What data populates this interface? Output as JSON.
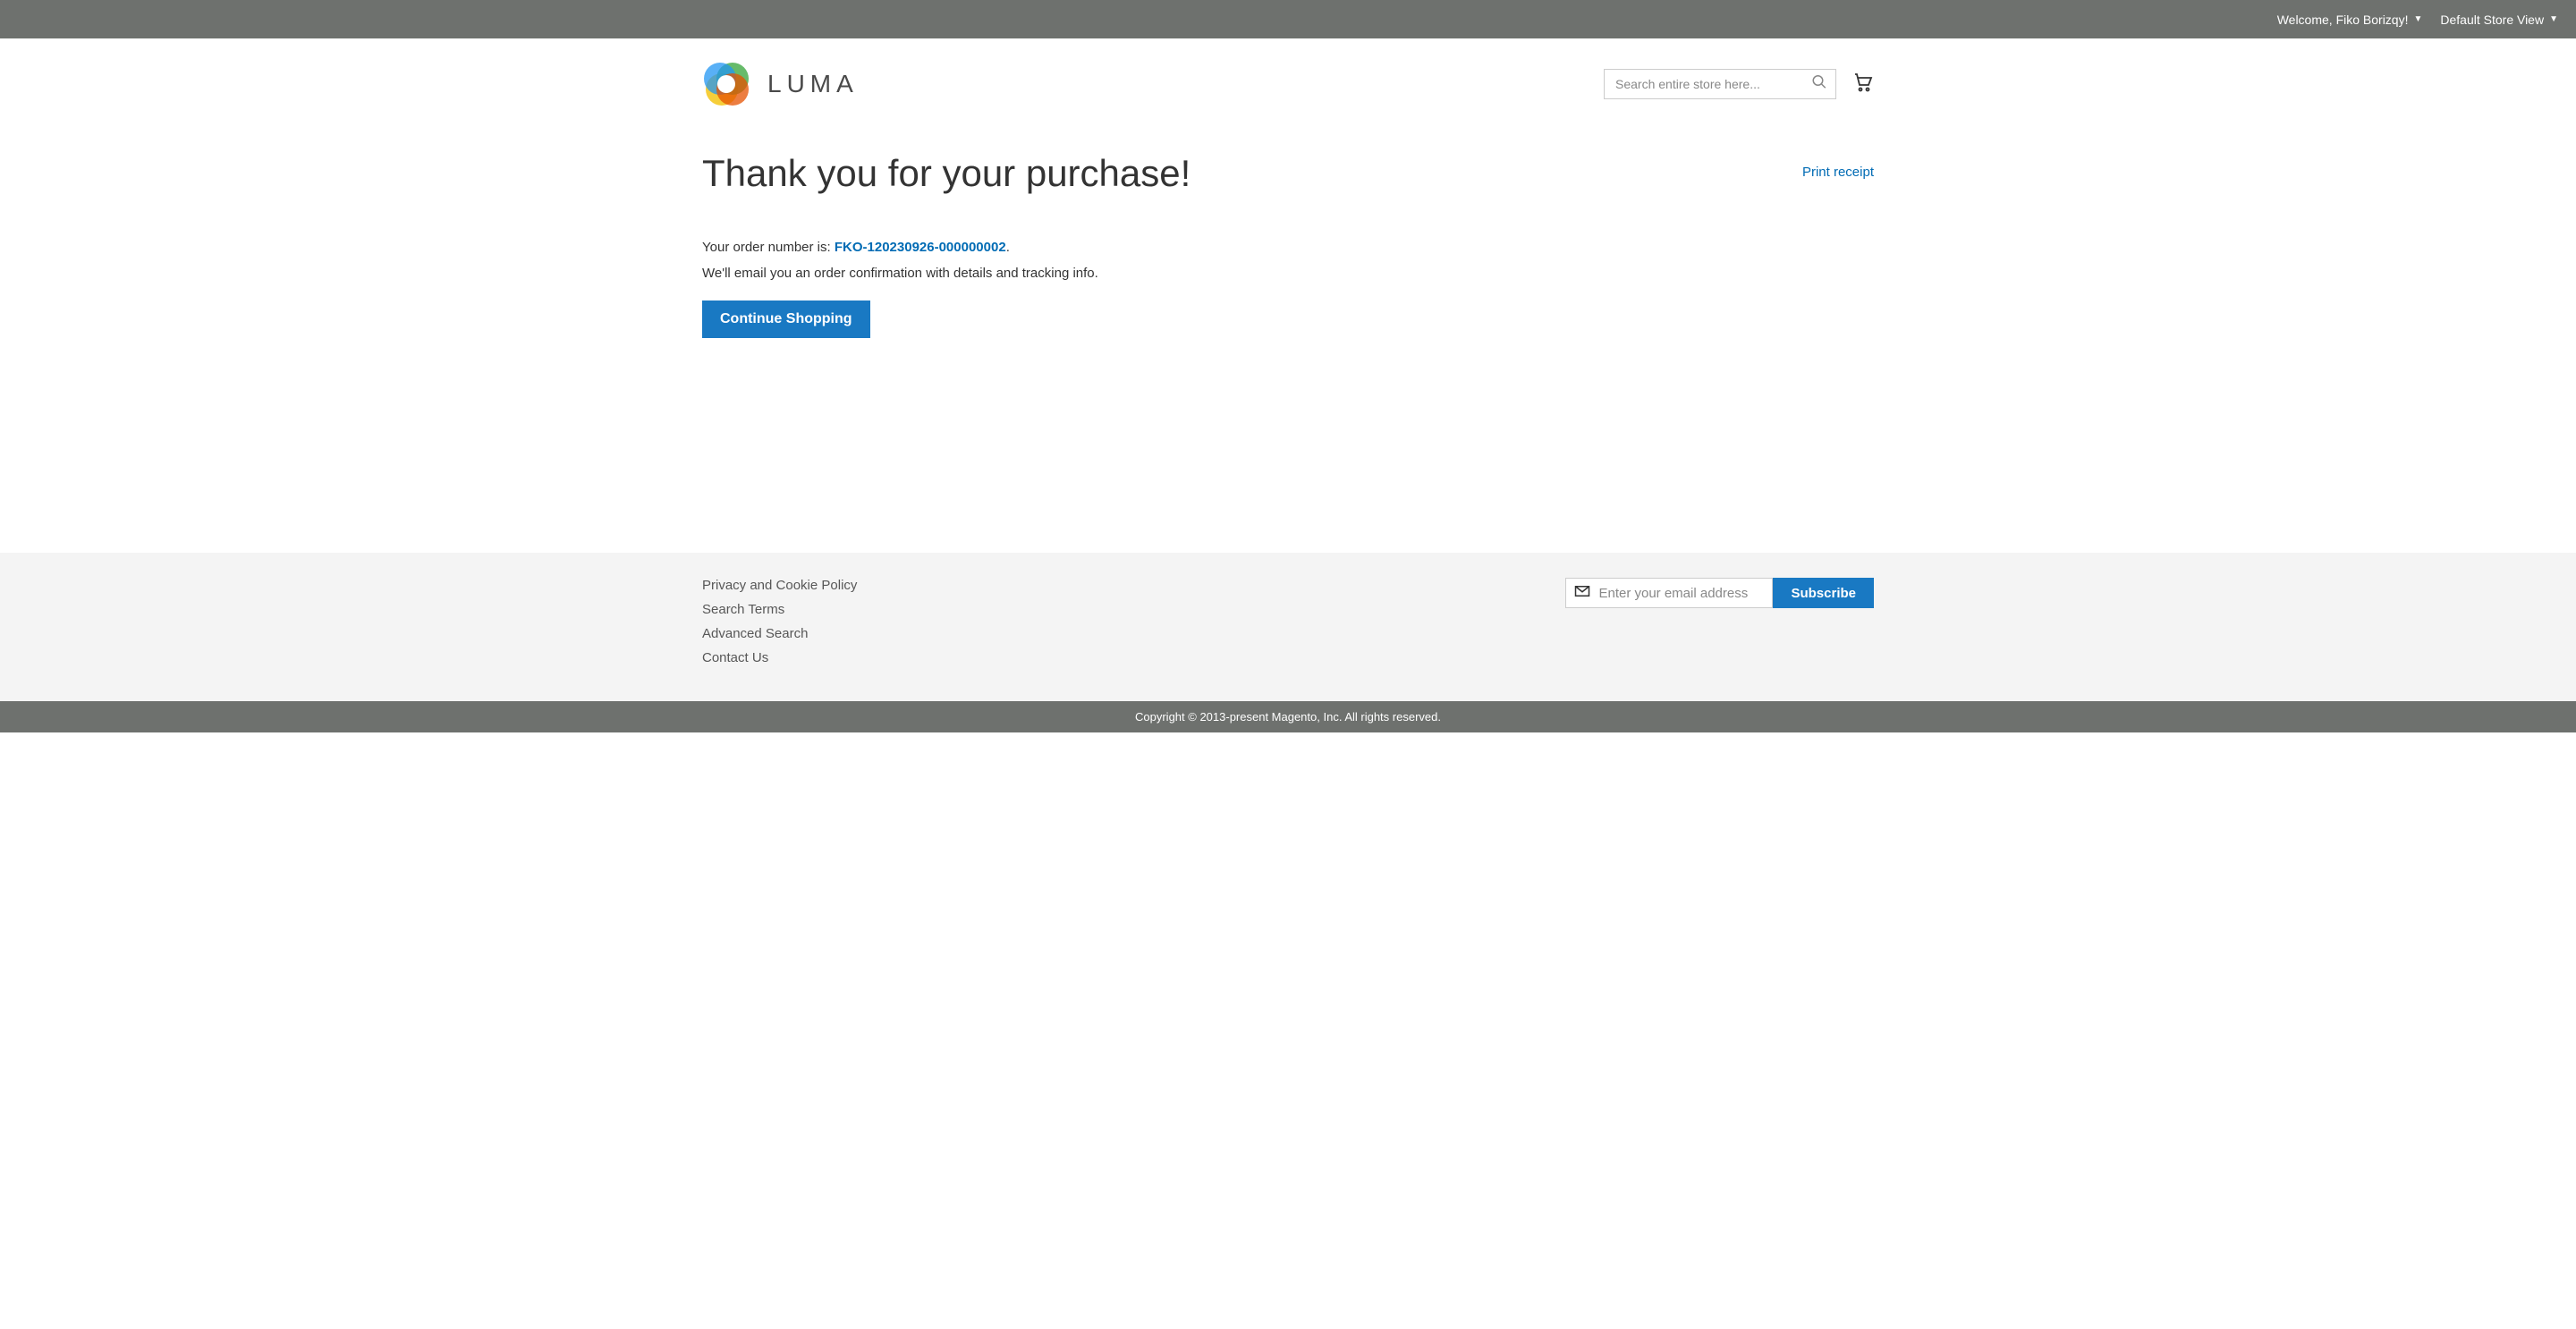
{
  "topbar": {
    "welcome": "Welcome, Fiko Borizqy!",
    "store_view": "Default Store View"
  },
  "header": {
    "logo_text": "LUMA",
    "search_placeholder": "Search entire store here..."
  },
  "main": {
    "title": "Thank you for your purchase!",
    "print_label": "Print receipt",
    "order_prefix": "Your order number is: ",
    "order_number": "FKO-120230926-000000002",
    "order_suffix": ".",
    "email_info": "We'll email you an order confirmation with details and tracking info.",
    "continue_label": "Continue Shopping"
  },
  "footer": {
    "links": [
      "Privacy and Cookie Policy",
      "Search Terms",
      "Advanced Search",
      "Contact Us"
    ],
    "newsletter_placeholder": "Enter your email address",
    "subscribe_label": "Subscribe"
  },
  "copyright": "Copyright © 2013-present Magento, Inc. All rights reserved."
}
